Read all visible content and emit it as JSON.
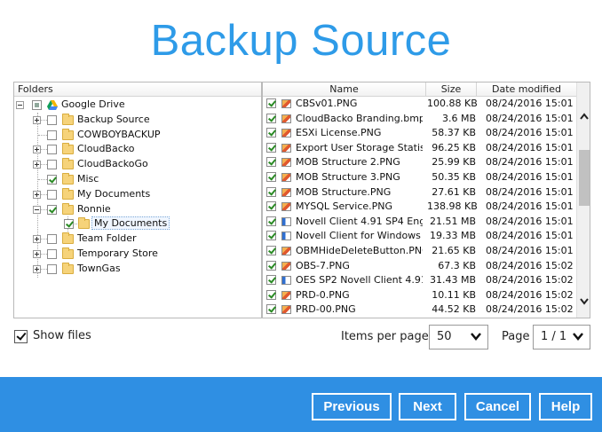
{
  "title": "Backup Source",
  "tree": {
    "header": "Folders",
    "root_label": "Google Drive",
    "items": [
      {
        "label": "Backup Source"
      },
      {
        "label": "COWBOYBACKUP"
      },
      {
        "label": "CloudBacko"
      },
      {
        "label": "CloudBackoGo"
      },
      {
        "label": "Misc"
      },
      {
        "label": "My Documents"
      },
      {
        "label": "Ronnie"
      },
      {
        "label": "My Documents"
      },
      {
        "label": "Team Folder"
      },
      {
        "label": "Temporary Store"
      },
      {
        "label": "TownGas"
      }
    ]
  },
  "files": {
    "headers": {
      "name": "Name",
      "size": "Size",
      "date": "Date modified"
    },
    "rows": [
      {
        "name": "CBSv01.PNG",
        "size": "100.88 KB",
        "date": "08/24/2016 15:01",
        "icon": "image-icon"
      },
      {
        "name": "CloudBacko Branding.bmp",
        "size": "3.6 MB",
        "date": "08/24/2016 15:01",
        "icon": "image-icon"
      },
      {
        "name": "ESXi License.PNG",
        "size": "58.37 KB",
        "date": "08/24/2016 15:01",
        "icon": "image-icon"
      },
      {
        "name": "Export User Storage Statis...",
        "size": "96.25 KB",
        "date": "08/24/2016 15:01",
        "icon": "image-icon"
      },
      {
        "name": "MOB Structure 2.PNG",
        "size": "25.99 KB",
        "date": "08/24/2016 15:01",
        "icon": "image-icon"
      },
      {
        "name": "MOB Structure 3.PNG",
        "size": "50.35 KB",
        "date": "08/24/2016 15:01",
        "icon": "image-icon"
      },
      {
        "name": "MOB Structure.PNG",
        "size": "27.61 KB",
        "date": "08/24/2016 15:01",
        "icon": "image-icon"
      },
      {
        "name": "MYSQL Service.PNG",
        "size": "138.98 KB",
        "date": "08/24/2016 15:01",
        "icon": "image-icon"
      },
      {
        "name": "Novell Client 4.91 SP4 Eng...",
        "size": "21.51 MB",
        "date": "08/24/2016 15:01",
        "icon": "executable-icon"
      },
      {
        "name": "Novell Client for Windows ...",
        "size": "19.33 MB",
        "date": "08/24/2016 15:01",
        "icon": "executable-icon"
      },
      {
        "name": "OBMHideDeleteButton.PNG",
        "size": "21.65 KB",
        "date": "08/24/2016 15:01",
        "icon": "image-icon"
      },
      {
        "name": "OBS-7.PNG",
        "size": "67.3 KB",
        "date": "08/24/2016 15:02",
        "icon": "image-icon"
      },
      {
        "name": "OES SP2 Novell Client 4.91...",
        "size": "31.43 MB",
        "date": "08/24/2016 15:02",
        "icon": "executable-icon"
      },
      {
        "name": "PRD-0.PNG",
        "size": "10.11 KB",
        "date": "08/24/2016 15:02",
        "icon": "image-icon"
      },
      {
        "name": "PRD-00.PNG",
        "size": "44.52 KB",
        "date": "08/24/2016 15:02",
        "icon": "image-icon"
      }
    ]
  },
  "show_files_label": "Show files",
  "items_per_page": {
    "label": "Items per page",
    "value": "50"
  },
  "page": {
    "label": "Page",
    "value": "1 / 1"
  },
  "buttons": {
    "previous": "Previous",
    "next": "Next",
    "cancel": "Cancel",
    "help": "Help"
  },
  "colors": {
    "accent": "#2f8fe3",
    "title": "#2e9be8"
  }
}
